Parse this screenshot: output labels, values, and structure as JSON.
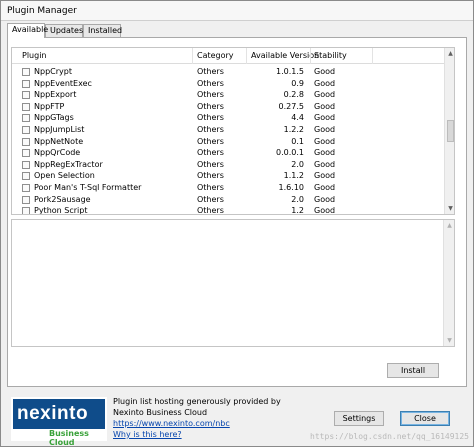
{
  "window": {
    "title": "Plugin Manager"
  },
  "tabs": [
    {
      "label": "Available",
      "active": true
    },
    {
      "label": "Updates",
      "active": false
    },
    {
      "label": "Installed",
      "active": false
    }
  ],
  "list": {
    "columns": [
      "Plugin",
      "Category",
      "Available Version",
      "Stability"
    ],
    "rows": [
      {
        "name": "NppCrypt",
        "category": "Others",
        "version": "1.0.1.5",
        "stability": "Good"
      },
      {
        "name": "NppEventExec",
        "category": "Others",
        "version": "0.9",
        "stability": "Good"
      },
      {
        "name": "NppExport",
        "category": "Others",
        "version": "0.2.8",
        "stability": "Good"
      },
      {
        "name": "NppFTP",
        "category": "Others",
        "version": "0.27.5",
        "stability": "Good"
      },
      {
        "name": "NppGTags",
        "category": "Others",
        "version": "4.4",
        "stability": "Good"
      },
      {
        "name": "NppJumpList",
        "category": "Others",
        "version": "1.2.2",
        "stability": "Good"
      },
      {
        "name": "NppNetNote",
        "category": "Others",
        "version": "0.1",
        "stability": "Good"
      },
      {
        "name": "NppQrCode",
        "category": "Others",
        "version": "0.0.0.1",
        "stability": "Good"
      },
      {
        "name": "NppRegExTractor",
        "category": "Others",
        "version": "2.0",
        "stability": "Good"
      },
      {
        "name": "Open Selection",
        "category": "Others",
        "version": "1.1.2",
        "stability": "Good"
      },
      {
        "name": "Poor Man's T-Sql Formatter",
        "category": "Others",
        "version": "1.6.10",
        "stability": "Good"
      },
      {
        "name": "Pork2Sausage",
        "category": "Others",
        "version": "2.0",
        "stability": "Good"
      },
      {
        "name": "Python Script",
        "category": "Others",
        "version": "1.2",
        "stability": "Good"
      }
    ]
  },
  "buttons": {
    "install": "Install",
    "settings": "Settings",
    "close": "Close"
  },
  "footer": {
    "logo_text": "nexinto",
    "logo_tagline": "Business Cloud",
    "line1": "Plugin list hosting generously provided by",
    "line2": "Nexinto Business Cloud",
    "link": "https://www.nexinto.com/nbc",
    "why": "Why is this here?",
    "watermark": "https://blog.csdn.net/qq_16149125"
  },
  "colors": {
    "logo_bg": "#0f4c8a",
    "logo_tagline": "#3aa23a",
    "link": "#0645ad"
  },
  "icons": {
    "scroll_up": "▲",
    "scroll_down": "▼"
  }
}
